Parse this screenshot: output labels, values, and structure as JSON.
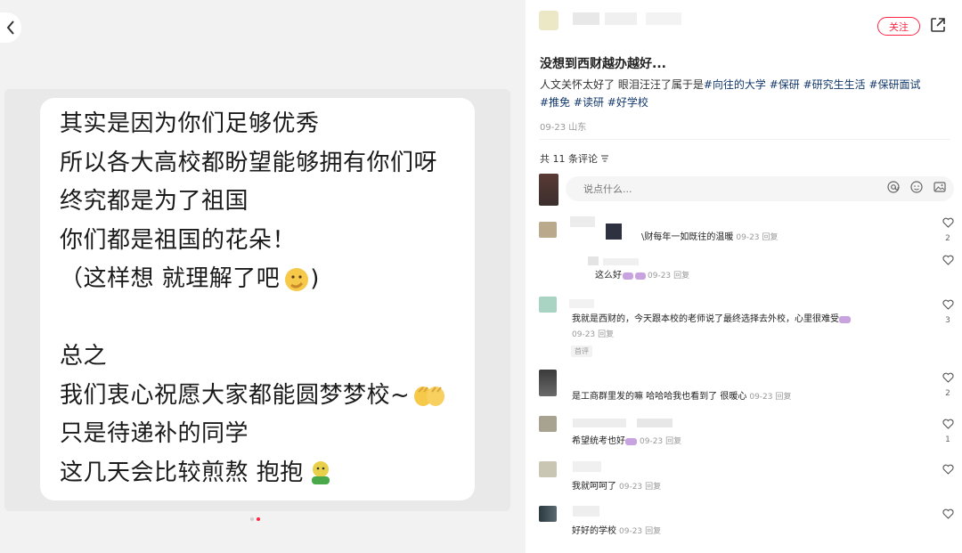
{
  "image_text": {
    "lines": [
      "其实是因为你们足够优秀",
      "所以各大高校都盼望能够拥有你们呀",
      "终究都是为了祖国",
      "你们都是祖国的花朵！",
      "（这样想 就理解了吧",
      "",
      "总之",
      "我们衷心祝愿大家都能圆梦梦校~",
      "只是待递补的同学",
      "这几天会比较煎熬 抱抱"
    ]
  },
  "post": {
    "follow_label": "关注",
    "title": "没想到西财越办越好...",
    "body_text": "人文关怀太好了 眼泪汪汪了属于是",
    "tags": [
      "#向往的大学",
      "#保研",
      "#研究生生活",
      "#保研面试",
      "#推免",
      "#读研",
      "#好学校"
    ],
    "date": "09-23",
    "location": "山东"
  },
  "comments_section": {
    "count_label": "共 11 条评论",
    "input_placeholder": "说点什么...",
    "items": [
      {
        "text": "\\财每年一如既往的温暖",
        "time": "09-23",
        "reply": "回复",
        "likes": "2"
      },
      {
        "text": "这么好",
        "time": "09-23",
        "reply": "回复",
        "likes": ""
      },
      {
        "text": "我就是西财的，今天跟本校的老师说了最终选择去外校，心里很难受",
        "time": "09-23",
        "reply": "回复",
        "likes": "3",
        "tag": "首评"
      },
      {
        "text": "是工商群里发的嘛 哈哈哈我也看到了 很暖心",
        "time": "09-23",
        "reply": "回复",
        "likes": "2"
      },
      {
        "text": "希望统考也好",
        "time": "09-23",
        "reply": "回复",
        "likes": "1"
      },
      {
        "text": "我就呵呵了",
        "time": "09-23",
        "reply": "回复",
        "likes": ""
      },
      {
        "text": "好好的学校",
        "time": "09-23",
        "reply": "回复",
        "likes": ""
      }
    ]
  },
  "colors": {
    "accent": "#ff2442",
    "tag": "#13386c"
  }
}
